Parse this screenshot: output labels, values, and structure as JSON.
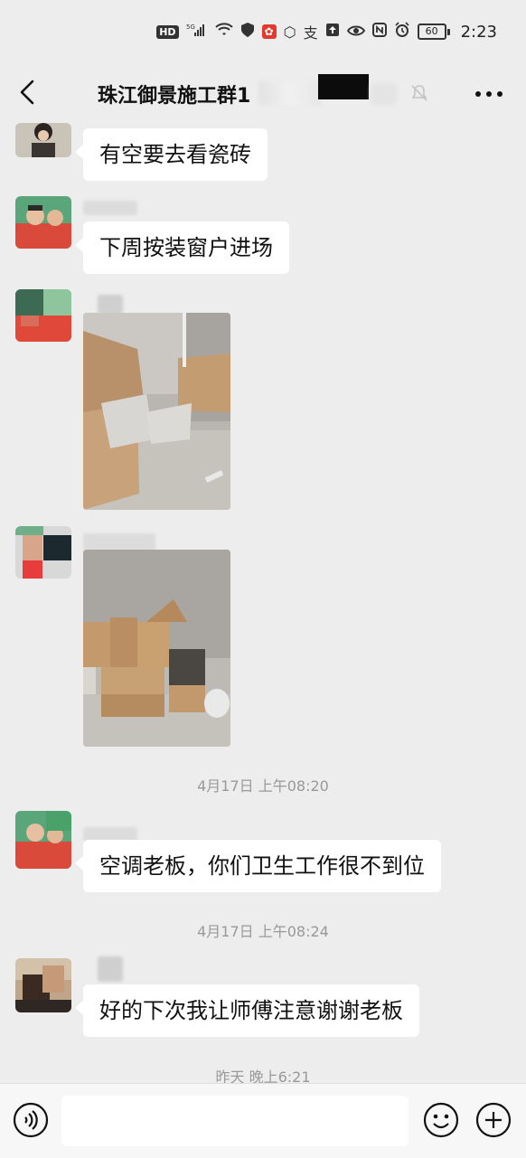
{
  "status_bar": {
    "hd": "HD",
    "network": "5G",
    "battery": "60",
    "time": "2:23"
  },
  "header": {
    "title": "珠江御景施工群1",
    "back_icon": "chevron-left-icon",
    "mute_icon": "bell-off-icon",
    "more_icon": "more-dots-icon"
  },
  "messages": [
    {
      "type": "text",
      "text": "有空要去看瓷砖"
    },
    {
      "type": "text",
      "text": "下周按装窗户进场"
    },
    {
      "type": "image",
      "content": "photo-cardboard-boxes-room"
    },
    {
      "type": "image",
      "content": "photo-stacked-boxes"
    },
    {
      "type": "timestamp",
      "text": "4月17日 上午08:20"
    },
    {
      "type": "text",
      "text": "空调老板，你们卫生工作很不到位"
    },
    {
      "type": "timestamp",
      "text": "4月17日 上午08:24"
    },
    {
      "type": "text",
      "text": "好的下次我让师傅注意谢谢老板"
    },
    {
      "type": "timestamp",
      "text": "昨天 晚上6:21"
    }
  ],
  "input_bar": {
    "voice_icon": "voice-icon",
    "input_value": "",
    "emoji_icon": "emoji-icon",
    "plus_icon": "plus-icon"
  },
  "colors": {
    "background": "#ededed",
    "bubble": "#ffffff",
    "timestamp": "#999999"
  }
}
